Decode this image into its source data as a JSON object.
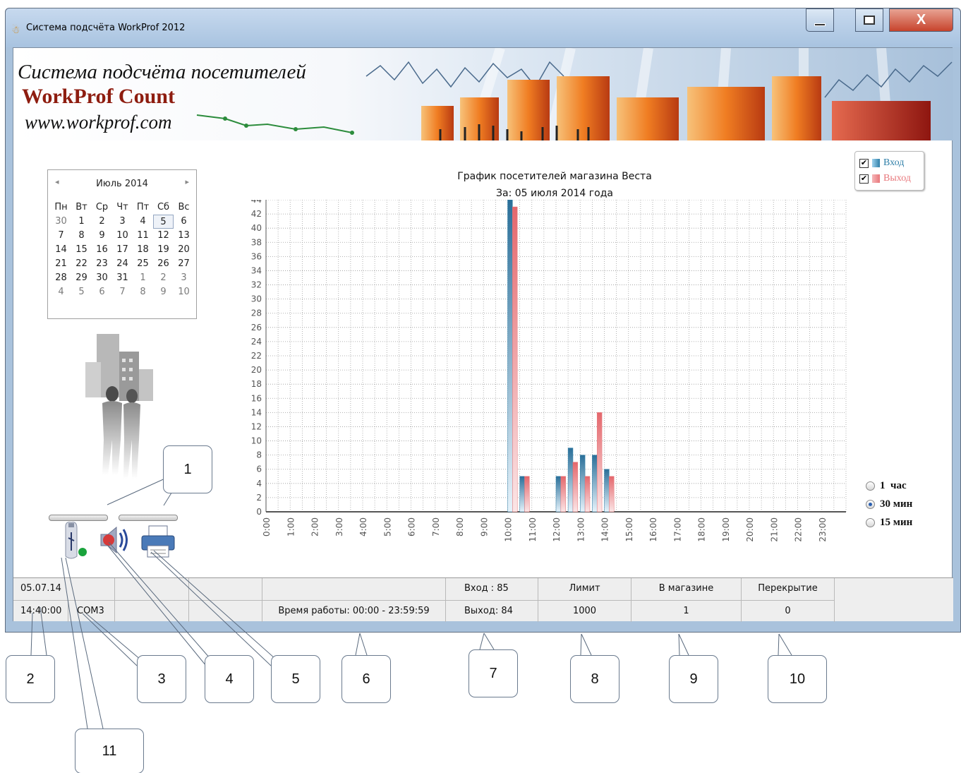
{
  "window": {
    "title": "Система подсчёта  WorkProf 2012",
    "close_glyph": "X"
  },
  "banner": {
    "line1": "Система подсчёта посетителей",
    "line2": "WorkProf Count",
    "line3": "www.workprof.com"
  },
  "calendar": {
    "month_label": "Июль 2014",
    "prev": "◂",
    "next": "▸",
    "weekdays": [
      "Пн",
      "Вт",
      "Ср",
      "Чт",
      "Пт",
      "Сб",
      "Вс"
    ],
    "weeks": [
      [
        "30",
        "1",
        "2",
        "3",
        "4",
        "5",
        "6"
      ],
      [
        "7",
        "8",
        "9",
        "10",
        "11",
        "12",
        "13"
      ],
      [
        "14",
        "15",
        "16",
        "17",
        "18",
        "19",
        "20"
      ],
      [
        "21",
        "22",
        "23",
        "24",
        "25",
        "26",
        "27"
      ],
      [
        "28",
        "29",
        "30",
        "31",
        "1",
        "2",
        "3"
      ],
      [
        "4",
        "5",
        "6",
        "7",
        "8",
        "9",
        "10"
      ]
    ],
    "selected": "5"
  },
  "devices": {
    "icons": [
      "usb-device-icon",
      "sound-icon",
      "printer-icon"
    ]
  },
  "chart": {
    "title": "График посетителей магазина  Веста",
    "subtitle": "За:  05 июля 2014  года",
    "legend": {
      "in_label": "Вход",
      "out_label": "Выход"
    }
  },
  "chart_data": {
    "type": "bar",
    "title": "График посетителей магазина  Веста",
    "subtitle": "За:  05 июля 2014  года",
    "categories": [
      "0:00",
      "1:00",
      "2:00",
      "3:00",
      "4:00",
      "5:00",
      "6:00",
      "7:00",
      "8:00",
      "9:00",
      "10:00",
      "11:00",
      "12:00",
      "13:00",
      "14:00",
      "15:00",
      "16:00",
      "17:00",
      "18:00",
      "19:00",
      "20:00",
      "21:00",
      "22:00",
      "23:00"
    ],
    "ylim": [
      0,
      44
    ],
    "ytick_step": 2,
    "slots_per_hour": 2,
    "series": [
      {
        "name": "Вход",
        "color": "#2f7fa8",
        "points": [
          [
            10.0,
            44
          ],
          [
            10.5,
            5
          ],
          [
            12.0,
            5
          ],
          [
            12.5,
            9
          ],
          [
            13.0,
            8
          ],
          [
            13.5,
            8
          ],
          [
            14.0,
            6
          ]
        ]
      },
      {
        "name": "Выход",
        "color": "#e8777b",
        "points": [
          [
            10.0,
            43
          ],
          [
            10.5,
            5
          ],
          [
            12.0,
            5
          ],
          [
            12.5,
            7
          ],
          [
            13.0,
            5
          ],
          [
            13.5,
            14
          ],
          [
            14.0,
            5
          ]
        ]
      }
    ],
    "grid": true,
    "legend_position": "top-right"
  },
  "interval": {
    "options": [
      "1  час",
      "30 мин",
      "15 мин"
    ],
    "selected": "30 мин"
  },
  "status": {
    "date": "05.07.14",
    "time": "14:40:00",
    "port": "COM3",
    "work_time": "Время работы:  00:00 - 23:59:59",
    "in": "Вход  : 85",
    "out": "Выход: 84",
    "limit_label": "Лимит",
    "limit_value": "1000",
    "in_store_label": "В магазине",
    "in_store_value": "1",
    "overlap_label": "Перекрытие",
    "overlap_value": "0"
  },
  "callouts": [
    "1",
    "2",
    "3",
    "4",
    "5",
    "6",
    "7",
    "8",
    "9",
    "10",
    "11"
  ]
}
